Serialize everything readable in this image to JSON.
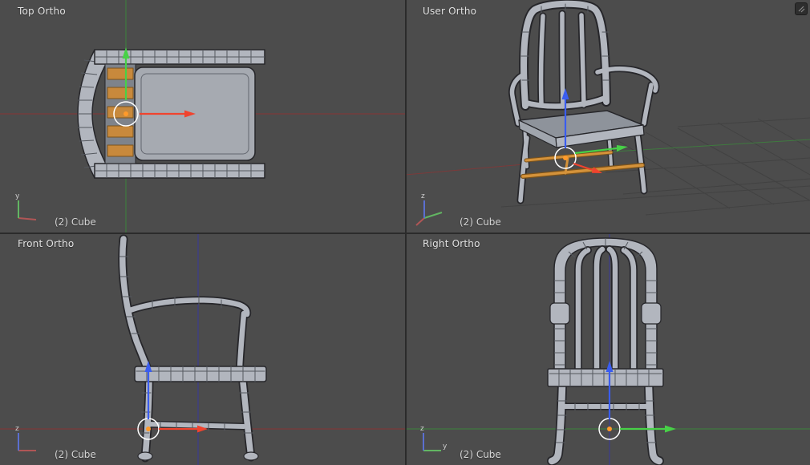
{
  "viewports": [
    {
      "id": "top",
      "label": "Top Ortho",
      "object_label": "(2) Cube",
      "gizmo_up_label": "y",
      "gizmo_right_label": ""
    },
    {
      "id": "user",
      "label": "User Ortho",
      "object_label": "(2) Cube",
      "gizmo_up_label": "z",
      "gizmo_right_label": ""
    },
    {
      "id": "front",
      "label": "Front Ortho",
      "object_label": "(2) Cube",
      "gizmo_up_label": "z",
      "gizmo_right_label": ""
    },
    {
      "id": "right",
      "label": "Right Ortho",
      "object_label": "(2) Cube",
      "gizmo_up_label": "z",
      "gizmo_right_label": "y"
    }
  ],
  "scene": {
    "selected_object_label": "(2) Cube"
  },
  "colors": {
    "viewport_background": "#4c4c4c",
    "viewport_divider": "#2b2b2b",
    "label_text": "#e2e2e2",
    "grid_axis_x": "#7c3a3a",
    "grid_axis_y": "#3f7a3f",
    "grid_axis_z": "#3c3c8e",
    "grid_line": "#424242",
    "manipulator_x_arrow": "#f0432e",
    "manipulator_y_arrow": "#47d147",
    "manipulator_z_arrow": "#3a5df0",
    "manipulator_ring": "#ffffff",
    "selection_highlight": "#d4923a",
    "origin_dot": "#ff9a2a",
    "mesh_fill": "#b2b6be",
    "mesh_outline": "#26262a"
  }
}
